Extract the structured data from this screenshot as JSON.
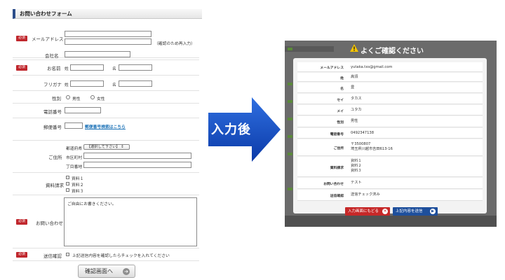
{
  "form": {
    "title": "お問い合わせフォーム",
    "required_badge": "必須",
    "email": {
      "label": "メールアドレス",
      "note": "（確認のため再入力）"
    },
    "company": {
      "label": "会社名"
    },
    "name": {
      "label": "お名前",
      "sei": "姓",
      "mei": "名"
    },
    "kana": {
      "label": "フリガナ",
      "sei": "姓",
      "mei": "名"
    },
    "gender": {
      "label": "性別",
      "options": [
        "男性",
        "女性"
      ]
    },
    "phone": {
      "label": "電話番号"
    },
    "zip": {
      "label": "郵便番号",
      "link": "郵便番号検索はこちら"
    },
    "address": {
      "label": "ご住所",
      "pref": "都道府県",
      "pref_select": "【選択して下さい】",
      "city": "市区町村",
      "street": "丁目番地"
    },
    "materials": {
      "label": "資料請求",
      "options": [
        "資料１",
        "資料２",
        "資料３"
      ]
    },
    "inquiry": {
      "label": "お問い合わせ",
      "placeholder": "ご自由にお書きください。"
    },
    "send_confirm": {
      "label": "送信確認",
      "text": "上記送信内容を確認したらチェックを入れてください"
    },
    "confirm_button": "確認画面へ"
  },
  "arrow_label": "入力後",
  "modal": {
    "title": "よくご確認ください",
    "rows": [
      {
        "label": "メールアドレス",
        "value": "yutaka.txs@gmail.com"
      },
      {
        "label": "姓",
        "value": "高須"
      },
      {
        "label": "名",
        "value": "豊"
      },
      {
        "label": "セイ",
        "value": "タカス"
      },
      {
        "label": "メイ",
        "value": "ユタカ"
      },
      {
        "label": "性別",
        "value": "男性"
      },
      {
        "label": "電話番号",
        "value": "0492347138"
      },
      {
        "label": "ご住所",
        "value": [
          "〒3500807",
          "埼玉県川越市吉田613-16"
        ]
      },
      {
        "label": "資料請求",
        "value": [
          "資料１",
          "資料２",
          "資料３"
        ]
      },
      {
        "label": "お問い合わせ",
        "value": "テスト"
      },
      {
        "label": "送信確認",
        "value": "送信チェック済み"
      }
    ],
    "back_button": "入力画面にもどる",
    "send_button": "上記内容を送信"
  }
}
